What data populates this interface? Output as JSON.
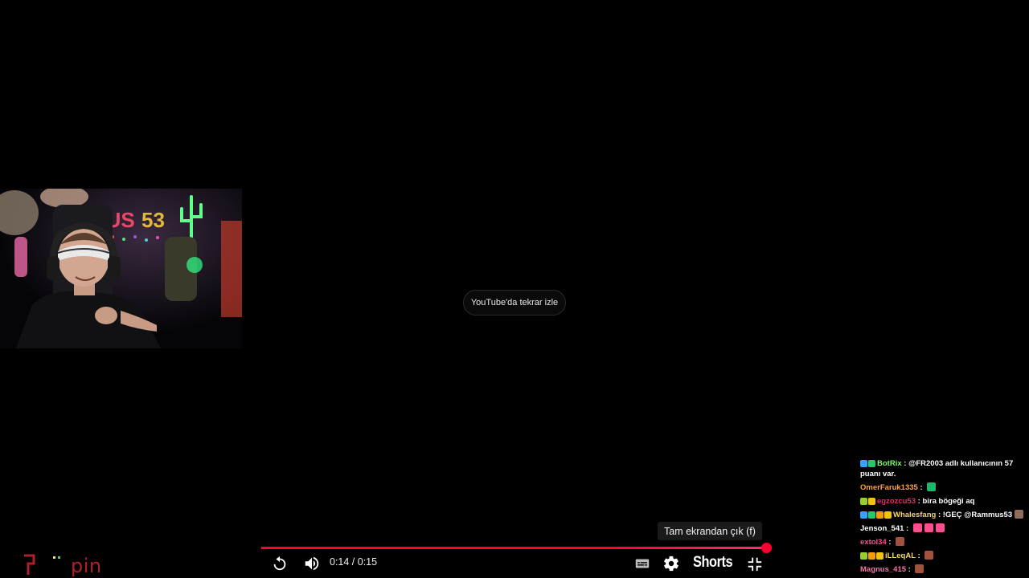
{
  "player": {
    "rewatch_label": "YouTube'da tekrar izle",
    "tooltip": "Tam ekrandan çık (f)",
    "time_display": "0:14 / 0:15",
    "progress_fraction": 0.995,
    "shorts_label": "Shorts",
    "accent_color": "#ff0033",
    "icons": {
      "replay": "replay-icon",
      "volume": "volume-icon",
      "subtitles": "subtitles-icon",
      "settings": "gear-icon",
      "exit_fullscreen": "exit-fullscreen-icon"
    }
  },
  "watermark": {
    "text": "pin",
    "color": "#b0202a"
  },
  "chat": {
    "messages": [
      {
        "user": "BotRix",
        "user_color": "#7cfc6a",
        "text": "@FR2003 adlı kullanıcının 57 puanı var.",
        "badges": [
          "#3aa0ff",
          "#28c76f"
        ]
      },
      {
        "user": "OmerFaruk1335",
        "user_color": "#ff9f43",
        "text": "",
        "badges": [],
        "emotes": [
          "#1fb86a"
        ]
      },
      {
        "user": "egzozcu53",
        "user_color": "#d6336c",
        "text": "bira bögeği aq",
        "badges": [
          "#9acd32",
          "#f1c40f"
        ]
      },
      {
        "user": "Whalesfang",
        "user_color": "#f5d76e",
        "text": "!GEÇ @Rammus53",
        "badges": [
          "#3aa0ff",
          "#28c76f",
          "#f39c12",
          "#f1c40f"
        ],
        "emotes": [
          "#8e6e5a"
        ]
      },
      {
        "user": "Jenson_541",
        "user_color": "#ffffff",
        "text": "",
        "badges": [],
        "emotes": [
          "#ff4d8d",
          "#ff4d8d",
          "#ff4d8d"
        ]
      },
      {
        "user": "extol34",
        "user_color": "#ff4d8d",
        "text": "",
        "badges": [],
        "emotes": [
          "#a0523d"
        ]
      },
      {
        "user": "iLLeqAL",
        "user_color": "#f5d76e",
        "text": "",
        "badges": [
          "#9acd32",
          "#f39c12",
          "#f1c40f"
        ],
        "emotes": [
          "#a0523d"
        ]
      },
      {
        "user": "Magnus_415",
        "user_color": "#ff6fae",
        "text": "",
        "badges": [],
        "emotes": [
          "#a0523d"
        ]
      }
    ]
  }
}
